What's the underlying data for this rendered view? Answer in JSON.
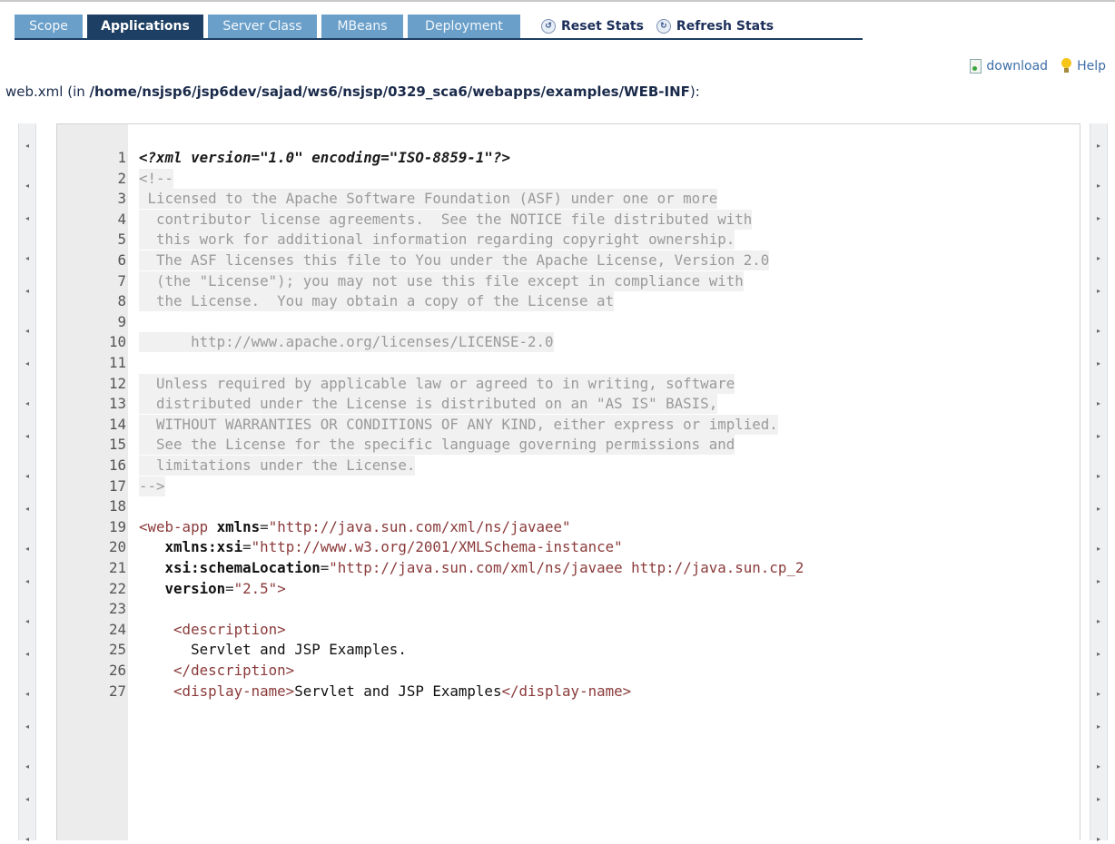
{
  "tabs": [
    {
      "label": "Scope",
      "active": false
    },
    {
      "label": "Applications",
      "active": true
    },
    {
      "label": "Server Class",
      "active": false
    },
    {
      "label": "MBeans",
      "active": false
    },
    {
      "label": "Deployment",
      "active": false
    }
  ],
  "actions": {
    "reset_label": "Reset Stats",
    "refresh_label": "Refresh Stats",
    "download_label": "download",
    "help_label": "Help"
  },
  "file": {
    "name": "web.xml",
    "path_prefix": " (in ",
    "path": "/home/nsjsp6/jsp6dev/sajad/ws6/nsjsp/0329_sca6/webapps/examples/WEB-INF",
    "path_suffix": "):"
  },
  "code_lines": [
    {
      "n": "1",
      "kind": "decl",
      "text": "<?xml version=\"1.0\" encoding=\"ISO-8859-1\"?>"
    },
    {
      "n": "2",
      "kind": "comment",
      "text": "<!--"
    },
    {
      "n": "3",
      "kind": "comment",
      "text": " Licensed to the Apache Software Foundation (ASF) under one or more"
    },
    {
      "n": "4",
      "kind": "comment",
      "text": "  contributor license agreements.  See the NOTICE file distributed with"
    },
    {
      "n": "5",
      "kind": "comment",
      "text": "  this work for additional information regarding copyright ownership."
    },
    {
      "n": "6",
      "kind": "comment",
      "text": "  The ASF licenses this file to You under the Apache License, Version 2.0"
    },
    {
      "n": "7",
      "kind": "comment",
      "text": "  (the \"License\"); you may not use this file except in compliance with"
    },
    {
      "n": "8",
      "kind": "comment",
      "text": "  the License.  You may obtain a copy of the License at"
    },
    {
      "n": "9",
      "kind": "comment",
      "text": ""
    },
    {
      "n": "10",
      "kind": "comment",
      "text": "      http://www.apache.org/licenses/LICENSE-2.0"
    },
    {
      "n": "11",
      "kind": "comment",
      "text": ""
    },
    {
      "n": "12",
      "kind": "comment",
      "text": "  Unless required by applicable law or agreed to in writing, software"
    },
    {
      "n": "13",
      "kind": "comment",
      "text": "  distributed under the License is distributed on an \"AS IS\" BASIS,"
    },
    {
      "n": "14",
      "kind": "comment",
      "text": "  WITHOUT WARRANTIES OR CONDITIONS OF ANY KIND, either express or implied."
    },
    {
      "n": "15",
      "kind": "comment",
      "text": "  See the License for the specific language governing permissions and"
    },
    {
      "n": "16",
      "kind": "comment",
      "text": "  limitations under the License."
    },
    {
      "n": "17",
      "kind": "comment",
      "text": "-->"
    },
    {
      "n": "18",
      "kind": "text",
      "text": ""
    },
    {
      "n": "19",
      "kind": "xml",
      "parts": [
        [
          "tag",
          "<web-app "
        ],
        [
          "attr",
          "xmlns"
        ],
        [
          "pun",
          "="
        ],
        [
          "val",
          "\"http://java.sun.com/xml/ns/javaee\""
        ]
      ]
    },
    {
      "n": "20",
      "kind": "xml",
      "parts": [
        [
          "txt",
          "   "
        ],
        [
          "attr",
          "xmlns:xsi"
        ],
        [
          "pun",
          "="
        ],
        [
          "val",
          "\"http://www.w3.org/2001/XMLSchema-instance\""
        ]
      ]
    },
    {
      "n": "21",
      "kind": "xml",
      "parts": [
        [
          "txt",
          "   "
        ],
        [
          "attr",
          "xsi:schemaLocation"
        ],
        [
          "pun",
          "="
        ],
        [
          "val",
          "\"http://java.sun.com/xml/ns/javaee http://java.sun.cp_2"
        ]
      ]
    },
    {
      "n": "22",
      "kind": "xml",
      "parts": [
        [
          "txt",
          "   "
        ],
        [
          "attr",
          "version"
        ],
        [
          "pun",
          "="
        ],
        [
          "val",
          "\"2.5\""
        ],
        [
          "tag",
          ">"
        ]
      ]
    },
    {
      "n": "23",
      "kind": "text",
      "text": ""
    },
    {
      "n": "24",
      "kind": "xml",
      "parts": [
        [
          "txt",
          "    "
        ],
        [
          "tag",
          "<description>"
        ]
      ]
    },
    {
      "n": "25",
      "kind": "xml",
      "parts": [
        [
          "txt",
          "      Servlet and JSP Examples."
        ]
      ]
    },
    {
      "n": "26",
      "kind": "xml",
      "parts": [
        [
          "txt",
          "    "
        ],
        [
          "tag",
          "</description>"
        ]
      ]
    },
    {
      "n": "27",
      "kind": "xml",
      "parts": [
        [
          "txt",
          "    "
        ],
        [
          "tag",
          "<display-name>"
        ],
        [
          "txt",
          "Servlet and JSP Examples"
        ],
        [
          "tag",
          "</display-name>"
        ]
      ]
    }
  ]
}
